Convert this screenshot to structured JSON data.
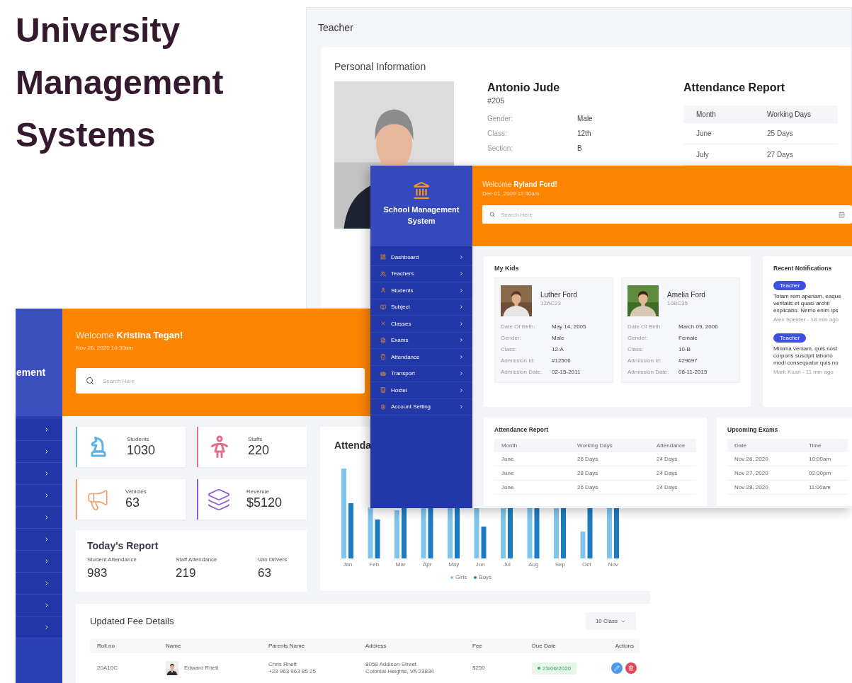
{
  "headline": "University Management Systems",
  "teacher_window": {
    "title": "Teacher",
    "section": "Personal Information",
    "name": "Antonio Jude",
    "id": "#205",
    "details": [
      {
        "label": "Gender:",
        "value": "Male"
      },
      {
        "label": "Class:",
        "value": "12th"
      },
      {
        "label": "Section:",
        "value": "B"
      }
    ],
    "attendance": {
      "title": "Attendance Report",
      "columns": [
        "Month",
        "Working Days"
      ],
      "rows": [
        [
          "June",
          "25 Days"
        ],
        [
          "July",
          "27 Days"
        ]
      ]
    }
  },
  "parent_window": {
    "brand": "School Management System",
    "menu": [
      "Dashboard",
      "Teachers",
      "Students",
      "Subject",
      "Classes",
      "Exams",
      "Attendance",
      "Transport",
      "Hostel",
      "Account Setting"
    ],
    "welcome": "Welcome **Ryland Ford!**",
    "date": "Dec 01, 2020 11:30am",
    "search_placeholder": "Search Here",
    "kids_title": "My Kids",
    "kids": [
      {
        "name": "Luther Ford",
        "code": "12AC23",
        "details": [
          [
            "Date Of Birth:",
            "May 14, 2005"
          ],
          [
            "Gender:",
            "Male"
          ],
          [
            "Class:",
            "12-A"
          ],
          [
            "Admission Id:",
            "#12506"
          ],
          [
            "Admission Date:",
            "02-15-2011"
          ]
        ]
      },
      {
        "name": "Amelia Ford",
        "code": "10BC35",
        "details": [
          [
            "Date Of Birth:",
            "March 09, 2006"
          ],
          [
            "Gender:",
            "Female"
          ],
          [
            "Class:",
            "10-B"
          ],
          [
            "Admission Id:",
            "#29697"
          ],
          [
            "Admission Date:",
            "08-11-2015"
          ]
        ]
      }
    ],
    "notifications": {
      "title": "Recent Notifications",
      "items": [
        {
          "tag": "Teacher",
          "lines": [
            "Totam rem aperiam, eaque",
            "veritatis et quasi archit",
            "explicabo. Nemo enim ips"
          ],
          "meta": "Alex Spelder - 18 min ago"
        },
        {
          "tag": "Teacher",
          "lines": [
            "Minima veniam, quis nost",
            "corporis suscipit laborio",
            "modi consequatur quis no"
          ],
          "meta": "Mark Kuan - 11 min ago"
        }
      ]
    },
    "attendance": {
      "title": "Attendance Report",
      "columns": [
        "Month",
        "Working Days",
        "Attendance"
      ],
      "rows": [
        [
          "June",
          "26 Days",
          "24 Days"
        ],
        [
          "June",
          "28 Days",
          "24 Days"
        ],
        [
          "June",
          "26 Days",
          "24 Days"
        ]
      ]
    },
    "exams": {
      "title": "Upcoming Exams",
      "columns": [
        "Date",
        "Time"
      ],
      "rows": [
        [
          "Nov 26, 2020",
          "10:00am"
        ],
        [
          "Nov 27, 2020",
          "02:00pm"
        ],
        [
          "Nov 28, 2020",
          "11:00am"
        ]
      ]
    }
  },
  "admin_window": {
    "brand_fragment": "ement",
    "welcome": "Welcome **Kristina Tegan!**",
    "date": "Nov 26, 2020 10:30am",
    "search_placeholder": "Search Here",
    "stats": [
      {
        "label": "Students",
        "value": "1030",
        "color": "#5ab4e0"
      },
      {
        "label": "Staffs",
        "value": "220",
        "color": "#e0708f"
      },
      {
        "label": "Vehicles",
        "value": "63",
        "color": "#f0a070"
      },
      {
        "label": "Revenue",
        "value": "$5120",
        "color": "#8a5cd0"
      }
    ],
    "report": {
      "title": "Today's Report",
      "items": [
        {
          "label": "Student Attendance",
          "value": "983"
        },
        {
          "label": "Staff Attendance",
          "value": "219"
        },
        {
          "label": "Van Drivers",
          "value": "63"
        }
      ]
    },
    "chart": {
      "title": "Attenda",
      "categories": [
        "Jan",
        "Feb",
        "Mar",
        "Apr",
        "May",
        "Jun",
        "Jul",
        "Aug",
        "Sep",
        "Oct",
        "Nov"
      ],
      "legend": [
        {
          "label": "Girls",
          "color": "#7fc4ec"
        },
        {
          "label": "Boys",
          "color": "#1b7cc4"
        }
      ]
    },
    "fees": {
      "title": "Updated Fee Details",
      "filter": "10 Class",
      "columns": [
        "Roll.no",
        "Name",
        "Parents Name",
        "Address",
        "Fee",
        "Due Date",
        "Actions"
      ],
      "rows": [
        {
          "roll": "20A10C",
          "name": "Edward Rhett",
          "parent": "Chris Rhett",
          "phone": "+23 963 963 85 25",
          "address": [
            "8058 Addison Street",
            "Colonial Heights, VA 23834"
          ],
          "fee": "$250",
          "due": "23/06/2020"
        }
      ]
    }
  }
}
